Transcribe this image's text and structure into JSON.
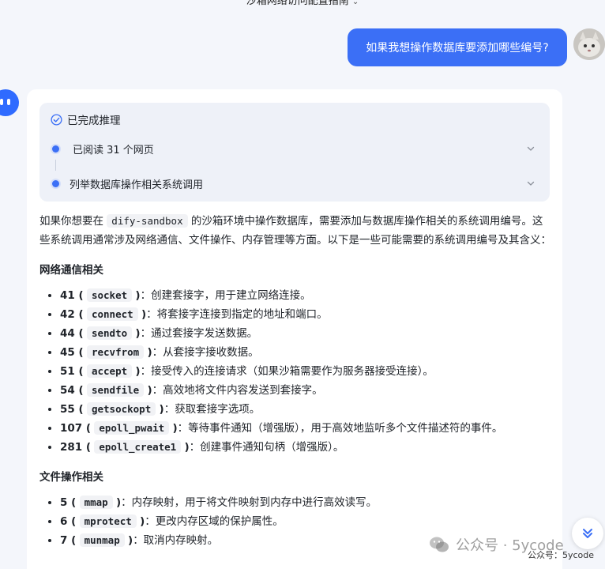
{
  "header": {
    "title": "沙箱网络访问配置指南"
  },
  "user_message": {
    "text": "如果我想操作数据库要添加哪些编号?"
  },
  "reasoning": {
    "status": "已完成推理",
    "steps": [
      {
        "label": "已阅读 31 个网页"
      },
      {
        "label": "列举数据库操作相关系统调用"
      }
    ]
  },
  "answer": {
    "intro_pre": "如果你想要在",
    "intro_code": "dify-sandbox",
    "intro_post": "的沙箱环境中操作数据库，需要添加与数据库操作相关的系统调用编号。这些系统调用通常涉及网络通信、文件操作、内存管理等方面。以下是一些可能需要的系统调用编号及其含义：",
    "sections": [
      {
        "title": "网络通信相关",
        "items": [
          {
            "num": "41 (",
            "call": "socket",
            "close": ")",
            "desc": "：创建套接字，用于建立网络连接。"
          },
          {
            "num": "42 (",
            "call": "connect",
            "close": ")",
            "desc": "：将套接字连接到指定的地址和端口。"
          },
          {
            "num": "44 (",
            "call": "sendto",
            "close": ")",
            "desc": "：通过套接字发送数据。"
          },
          {
            "num": "45 (",
            "call": "recvfrom",
            "close": ")",
            "desc": "：从套接字接收数据。"
          },
          {
            "num": "51 (",
            "call": "accept",
            "close": ")",
            "desc": "：接受传入的连接请求（如果沙箱需要作为服务器接受连接）。"
          },
          {
            "num": "54 (",
            "call": "sendfile",
            "close": ")",
            "desc": "：高效地将文件内容发送到套接字。"
          },
          {
            "num": "55 (",
            "call": "getsockopt",
            "close": ")",
            "desc": "：获取套接字选项。"
          },
          {
            "num": "107 (",
            "call": "epoll_pwait",
            "close": ")",
            "desc": "：等待事件通知（增强版），用于高效地监听多个文件描述符的事件。"
          },
          {
            "num": "281 (",
            "call": "epoll_create1",
            "close": ")",
            "desc": "：创建事件通知句柄（增强版）。"
          }
        ]
      },
      {
        "title": "文件操作相关",
        "items": [
          {
            "num": "5 (",
            "call": "mmap",
            "close": ")",
            "desc": "：内存映射，用于将文件映射到内存中进行高效读写。"
          },
          {
            "num": "6 (",
            "call": "mprotect",
            "close": ")",
            "desc": "：更改内存区域的保护属性。"
          },
          {
            "num": "7 (",
            "call": "munmap",
            "close": ")",
            "desc": "：取消内存映射。"
          }
        ]
      }
    ]
  },
  "watermark": {
    "text": "公众号 · 5ycode",
    "small_text": "公众号：5ycode"
  },
  "icons": {
    "title_chevron": "chevron-down-icon",
    "check": "check-circle-icon",
    "step_chevron": "chevron-down-icon",
    "scroll": "double-chevron-down-icon",
    "wechat": "wechat-icon"
  },
  "colors": {
    "accent": "#3b6ff6",
    "background": "#f4f6fb",
    "card": "#ffffff",
    "panel": "#eef1f8"
  }
}
